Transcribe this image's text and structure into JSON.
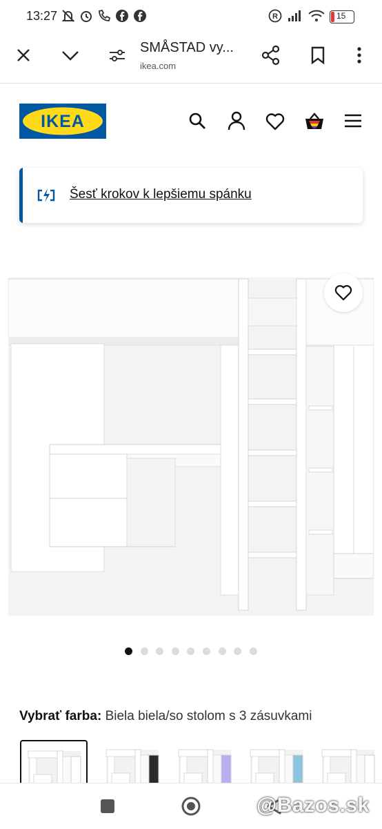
{
  "status_bar": {
    "time": "13:27",
    "battery": "15"
  },
  "browser": {
    "page_title": "SMÅSTAD vy...",
    "url": "ikea.com"
  },
  "header": {
    "logo_text": "IKEA"
  },
  "banner": {
    "text": "Šesť krokov k lepšiemu spánku"
  },
  "gallery": {
    "dot_count": 9,
    "active_index": 0
  },
  "color_selection": {
    "label": "Vybrať farba:",
    "value": "Biela biela/so stolom s 3 zásuvkami",
    "swatch_accents": [
      "#ffffff",
      "#2b2b2b",
      "#b8aef0",
      "#8fc3e0",
      "#ffffff"
    ]
  },
  "watermark": {
    "text": "@Bazos.sk"
  },
  "colors": {
    "ikea_blue": "#0058a3",
    "ikea_yellow": "#ffda1a"
  }
}
